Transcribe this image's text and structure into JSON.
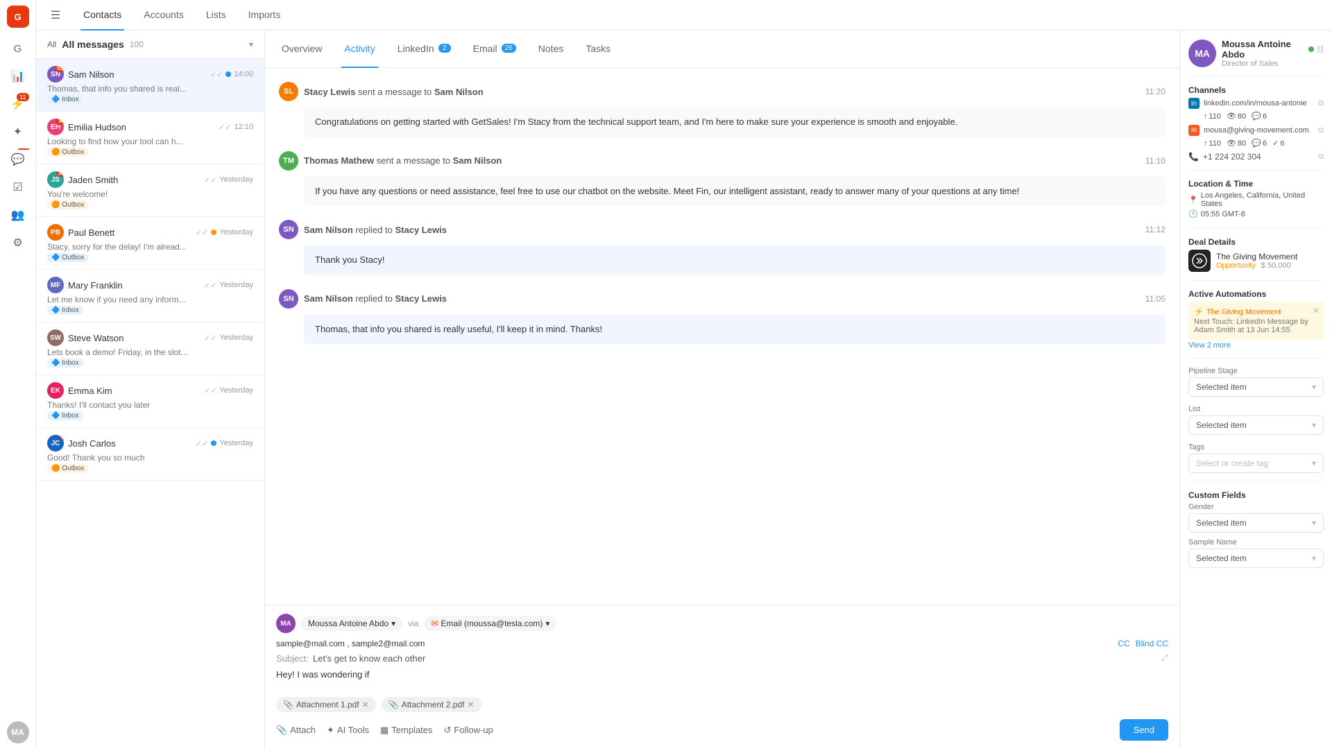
{
  "app": {
    "logo": "G",
    "logo_bg": "#e8380d"
  },
  "top_tabs": [
    {
      "id": "contacts",
      "label": "Contacts",
      "active": true
    },
    {
      "id": "accounts",
      "label": "Accounts",
      "active": false
    },
    {
      "id": "lists",
      "label": "Lists",
      "active": false
    },
    {
      "id": "imports",
      "label": "Imports",
      "active": false
    }
  ],
  "messages_header": {
    "all_label": "All",
    "messages_label": "All messages",
    "count": "100",
    "dropdown_icon": "▾"
  },
  "messages": [
    {
      "id": 1,
      "sender": "Sam Nilson",
      "avatar_initials": "SN",
      "avatar_color": "#7e57c2",
      "badge": "53",
      "preview": "Thomas, that info you shared is real...",
      "tag": "Inbox",
      "tag_type": "inbox",
      "time": "14:00",
      "selected": true,
      "has_dot": true,
      "dot_color": "blue"
    },
    {
      "id": 2,
      "sender": "Emilia Hudson",
      "avatar_initials": "EH",
      "avatar_color": "#ec407a",
      "badge": "8",
      "preview": "Looking to find how your tool can h...",
      "tag": "Outbox",
      "tag_type": "outbox",
      "time": "12:10",
      "selected": false,
      "has_dot": false
    },
    {
      "id": 3,
      "sender": "Jaden Smith",
      "avatar_initials": "JS",
      "avatar_color": "#26a69a",
      "badge": "20",
      "preview": "You're welcome!",
      "tag": "Outbox",
      "tag_type": "outbox",
      "time": "Yesterday",
      "selected": false,
      "has_dot": false
    },
    {
      "id": 4,
      "sender": "Paul Benett",
      "avatar_initials": "PB",
      "avatar_color": "#ef6c00",
      "badge": "",
      "preview": "Stacy, sorry for the delay! I'm alread...",
      "tag": "Outbox",
      "tag_type": "outbox",
      "time": "Yesterday",
      "selected": false,
      "has_dot": false,
      "dot_color": "orange"
    },
    {
      "id": 5,
      "sender": "Mary Franklin",
      "avatar_initials": "MF",
      "avatar_color": "#5c6bc0",
      "badge": "",
      "preview": "Let me know if you need any inform...",
      "tag": "Inbox",
      "tag_type": "inbox",
      "time": "Yesterday",
      "selected": false,
      "has_dot": false
    },
    {
      "id": 6,
      "sender": "Steve Watson",
      "avatar_initials": "SW",
      "avatar_color": "#8d6e63",
      "badge": "",
      "preview": "Lets book a demo! Friday, in the slot...",
      "tag": "Inbox",
      "tag_type": "inbox",
      "time": "Yesterday",
      "selected": false,
      "has_dot": false
    },
    {
      "id": 7,
      "sender": "Emma Kim",
      "avatar_initials": "EK",
      "avatar_color": "#e91e63",
      "badge": "",
      "preview": "Thanks! I'll contact you later",
      "tag": "Inbox",
      "tag_type": "inbox",
      "time": "Yesterday",
      "selected": false,
      "has_dot": false
    },
    {
      "id": 8,
      "sender": "Josh Carlos",
      "avatar_initials": "JC",
      "avatar_color": "#1565c0",
      "badge": "2",
      "preview": "Good! Thank you so much",
      "tag": "Outbox",
      "tag_type": "outbox",
      "time": "Yesterday",
      "selected": false,
      "has_dot": true,
      "dot_color": "blue"
    }
  ],
  "detail_tabs": [
    {
      "id": "overview",
      "label": "Overview",
      "badge": "",
      "active": false
    },
    {
      "id": "activity",
      "label": "Activity",
      "badge": "",
      "active": true
    },
    {
      "id": "linkedin",
      "label": "LinkedIn",
      "badge": "2",
      "active": false
    },
    {
      "id": "email",
      "label": "Email",
      "badge": "26",
      "active": false
    },
    {
      "id": "notes",
      "label": "Notes",
      "badge": "",
      "active": false
    },
    {
      "id": "tasks",
      "label": "Tasks",
      "badge": "",
      "active": false
    }
  ],
  "activity_messages": [
    {
      "id": 1,
      "type": "sent",
      "sender": "Stacy Lewis",
      "action": "sent a message to",
      "recipient": "Sam Nilson",
      "time": "11:20",
      "avatar_initials": "SL",
      "avatar_color": "#f57c00",
      "body": "Congratulations on getting started with GetSales! I'm Stacy from the technical support team, and I'm here to make sure your experience is smooth and enjoyable.",
      "is_reply": false
    },
    {
      "id": 2,
      "type": "sent",
      "sender": "Thomas Mathew",
      "action": "sent a message to",
      "recipient": "Sam Nilson",
      "time": "11:10",
      "avatar_initials": "TM",
      "avatar_color": "#4caf50",
      "body": "If you have any questions or need assistance, feel free to use our chatbot on the website. Meet Fin, our intelligent assistant, ready to answer many of your questions at any time!",
      "is_reply": false
    },
    {
      "id": 3,
      "type": "reply",
      "sender": "Sam Nilson",
      "action": "replied to",
      "recipient": "Stacy Lewis",
      "time": "11:12",
      "avatar_initials": "SN",
      "avatar_color": "#7e57c2",
      "body": "Thank you Stacy!",
      "is_reply": true
    },
    {
      "id": 4,
      "type": "reply",
      "sender": "Sam Nilson",
      "action": "replied to",
      "recipient": "Stacy Lewis",
      "time": "11:05",
      "avatar_initials": "SN",
      "avatar_color": "#7e57c2",
      "body": "Thomas, that info you shared is really useful, I'll keep it in mind. Thanks!",
      "is_reply": true
    }
  ],
  "compose": {
    "from_name": "Moussa Antoine Abdo",
    "from_initials": "MA",
    "via_label": "via",
    "email_label": "Email (moussa@tesla.com)",
    "to_text": "sample@mail.com , sample2@mail.com",
    "cc_label": "CC",
    "blind_cc_label": "Blind CC",
    "subject_label": "Subject:",
    "subject_text": "Let's get to know each other",
    "body_text": "Hey! I was wondering if",
    "attachments": [
      {
        "name": "Attachment 1.pdf"
      },
      {
        "name": "Attachment 2.pdf"
      }
    ],
    "tools": [
      {
        "id": "attach",
        "label": "Attach",
        "icon": "📎"
      },
      {
        "id": "ai-tools",
        "label": "AI Tools",
        "icon": "✦"
      },
      {
        "id": "templates",
        "label": "Templates",
        "icon": "▦"
      },
      {
        "id": "follow-up",
        "label": "Follow-up",
        "icon": "↺"
      }
    ],
    "send_label": "Send"
  },
  "right_panel": {
    "profile": {
      "name": "Moussa Antoine Abdo",
      "title": "Director of Sales",
      "initials": "MA",
      "avatar_color": "#7e57c2",
      "status_color": "#4caf50"
    },
    "channels_title": "Channels",
    "channels": [
      {
        "type": "linkedin",
        "label": "linkedin.com/in/mousa-antonie",
        "stats": [
          {
            "icon": "▲",
            "value": "110"
          },
          {
            "icon": "👁",
            "value": "80"
          },
          {
            "icon": "💬",
            "value": "6"
          }
        ]
      },
      {
        "type": "email",
        "label": "mousa@giving-movement.com",
        "stats": [
          {
            "icon": "▲",
            "value": "110"
          },
          {
            "icon": "👁",
            "value": "80"
          },
          {
            "icon": "💬",
            "value": "6"
          },
          {
            "icon": "✓",
            "value": "6"
          }
        ]
      }
    ],
    "phone": "+1 224 202 304",
    "location_title": "Location & Time",
    "location": "Los Angeles, California, United States",
    "time": "05:55  GMT-8",
    "deal_title": "Deal Details",
    "deal": {
      "name": "The Giving Movement",
      "opportunity": "Opportunity",
      "value": "$ 50,000",
      "logo": "TGM"
    },
    "automations_title": "Active Automations",
    "automation": {
      "name": "The Giving Movement",
      "detail": "Next Touch: LinkedIn Message by Adam Smith at 13 Jun 14:55"
    },
    "view_more_label": "View 2 more",
    "pipeline_title": "Pipeline Stage",
    "pipeline_value": "Selected item",
    "list_title": "List",
    "list_value": "Selected item",
    "tags_title": "Tags",
    "tags_placeholder": "Select or create tag",
    "custom_fields_title": "Custom Fields",
    "gender_label": "Gender",
    "gender_value": "Selected item",
    "sample_name_label": "Sample Name",
    "sample_name_value": "Selected item"
  }
}
